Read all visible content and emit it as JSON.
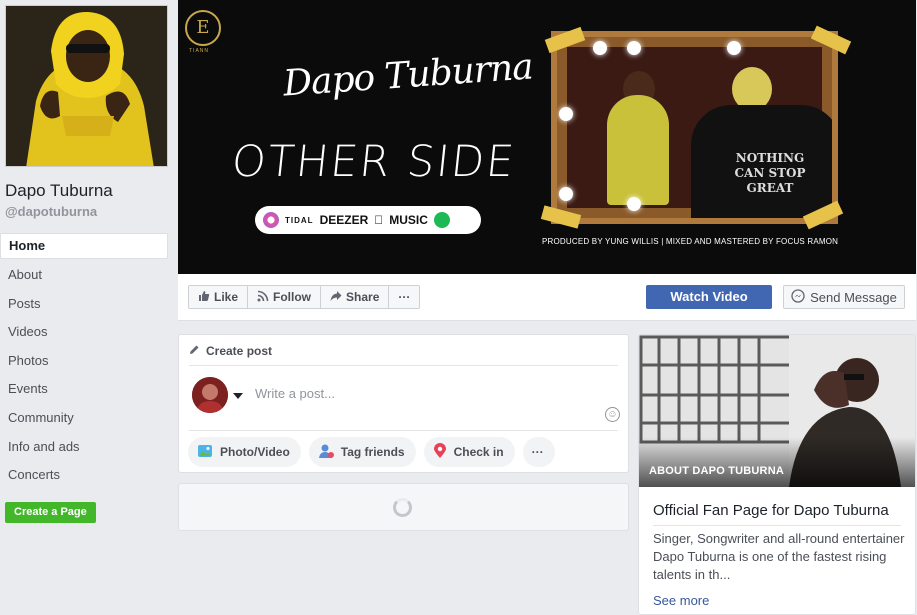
{
  "profile": {
    "name": "Dapo Tuburna",
    "handle": "@dapotuburna"
  },
  "nav": {
    "items": [
      {
        "label": "Home",
        "active": true
      },
      {
        "label": "About"
      },
      {
        "label": "Posts"
      },
      {
        "label": "Videos"
      },
      {
        "label": "Photos"
      },
      {
        "label": "Events"
      },
      {
        "label": "Community"
      },
      {
        "label": "Info and ads"
      },
      {
        "label": "Concerts"
      }
    ],
    "create_page": "Create a Page"
  },
  "cover": {
    "logo_letter": "E",
    "logo_sub": "TIANN",
    "artist": "Dapo Tuburna",
    "song": "OTHER SIDE",
    "platforms": [
      "TIDAL",
      "DEEZER",
      "MUSIC"
    ],
    "credits": "PRODUCED BY YUNG WILLIS | MIXED AND MASTERED BY FOCUS RAMON",
    "shirt_text": [
      "NOTHING",
      "CAN STOP",
      "GREAT"
    ]
  },
  "actions": {
    "like": "Like",
    "follow": "Follow",
    "share": "Share",
    "more": "···",
    "watch_video": "Watch Video",
    "send_message": "Send Message"
  },
  "composer": {
    "header": "Create post",
    "placeholder": "Write a post...",
    "chips": [
      "Photo/Video",
      "Tag friends",
      "Check in",
      "···"
    ]
  },
  "about": {
    "label": "ABOUT DAPO TUBURNA",
    "title": "Official Fan Page for Dapo Tuburna",
    "description": "Singer, Songwriter and all-round entertainer Dapo Tuburna is one of the fastest rising talents in th...",
    "see_more": "See more"
  },
  "colors": {
    "primary_button": "#4267b2",
    "create_page": "#42b72a",
    "link": "#385898",
    "background": "#e9ebee"
  }
}
